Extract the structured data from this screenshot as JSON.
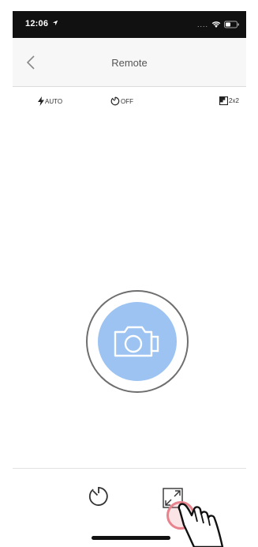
{
  "status_bar": {
    "time": "12:06",
    "location_icon": "location-arrow-icon",
    "signal": "....",
    "wifi_icon": "wifi-icon",
    "battery_icon": "battery-icon"
  },
  "nav": {
    "back_icon": "chevron-left-icon",
    "title": "Remote"
  },
  "settings": {
    "flash": {
      "icon": "flash-icon",
      "label": "AUTO"
    },
    "timer": {
      "icon": "timer-icon",
      "label": "OFF"
    },
    "grid": {
      "icon": "grid-size-icon",
      "label": "2x2"
    }
  },
  "shutter": {
    "icon": "camera-icon"
  },
  "bottom": {
    "timer_icon": "timer-icon",
    "resize_icon": "resize-icon"
  },
  "colors": {
    "shutter_fill": "#9cc3f2",
    "status_bar": "#111111",
    "tap_highlight": "#e8838d"
  }
}
